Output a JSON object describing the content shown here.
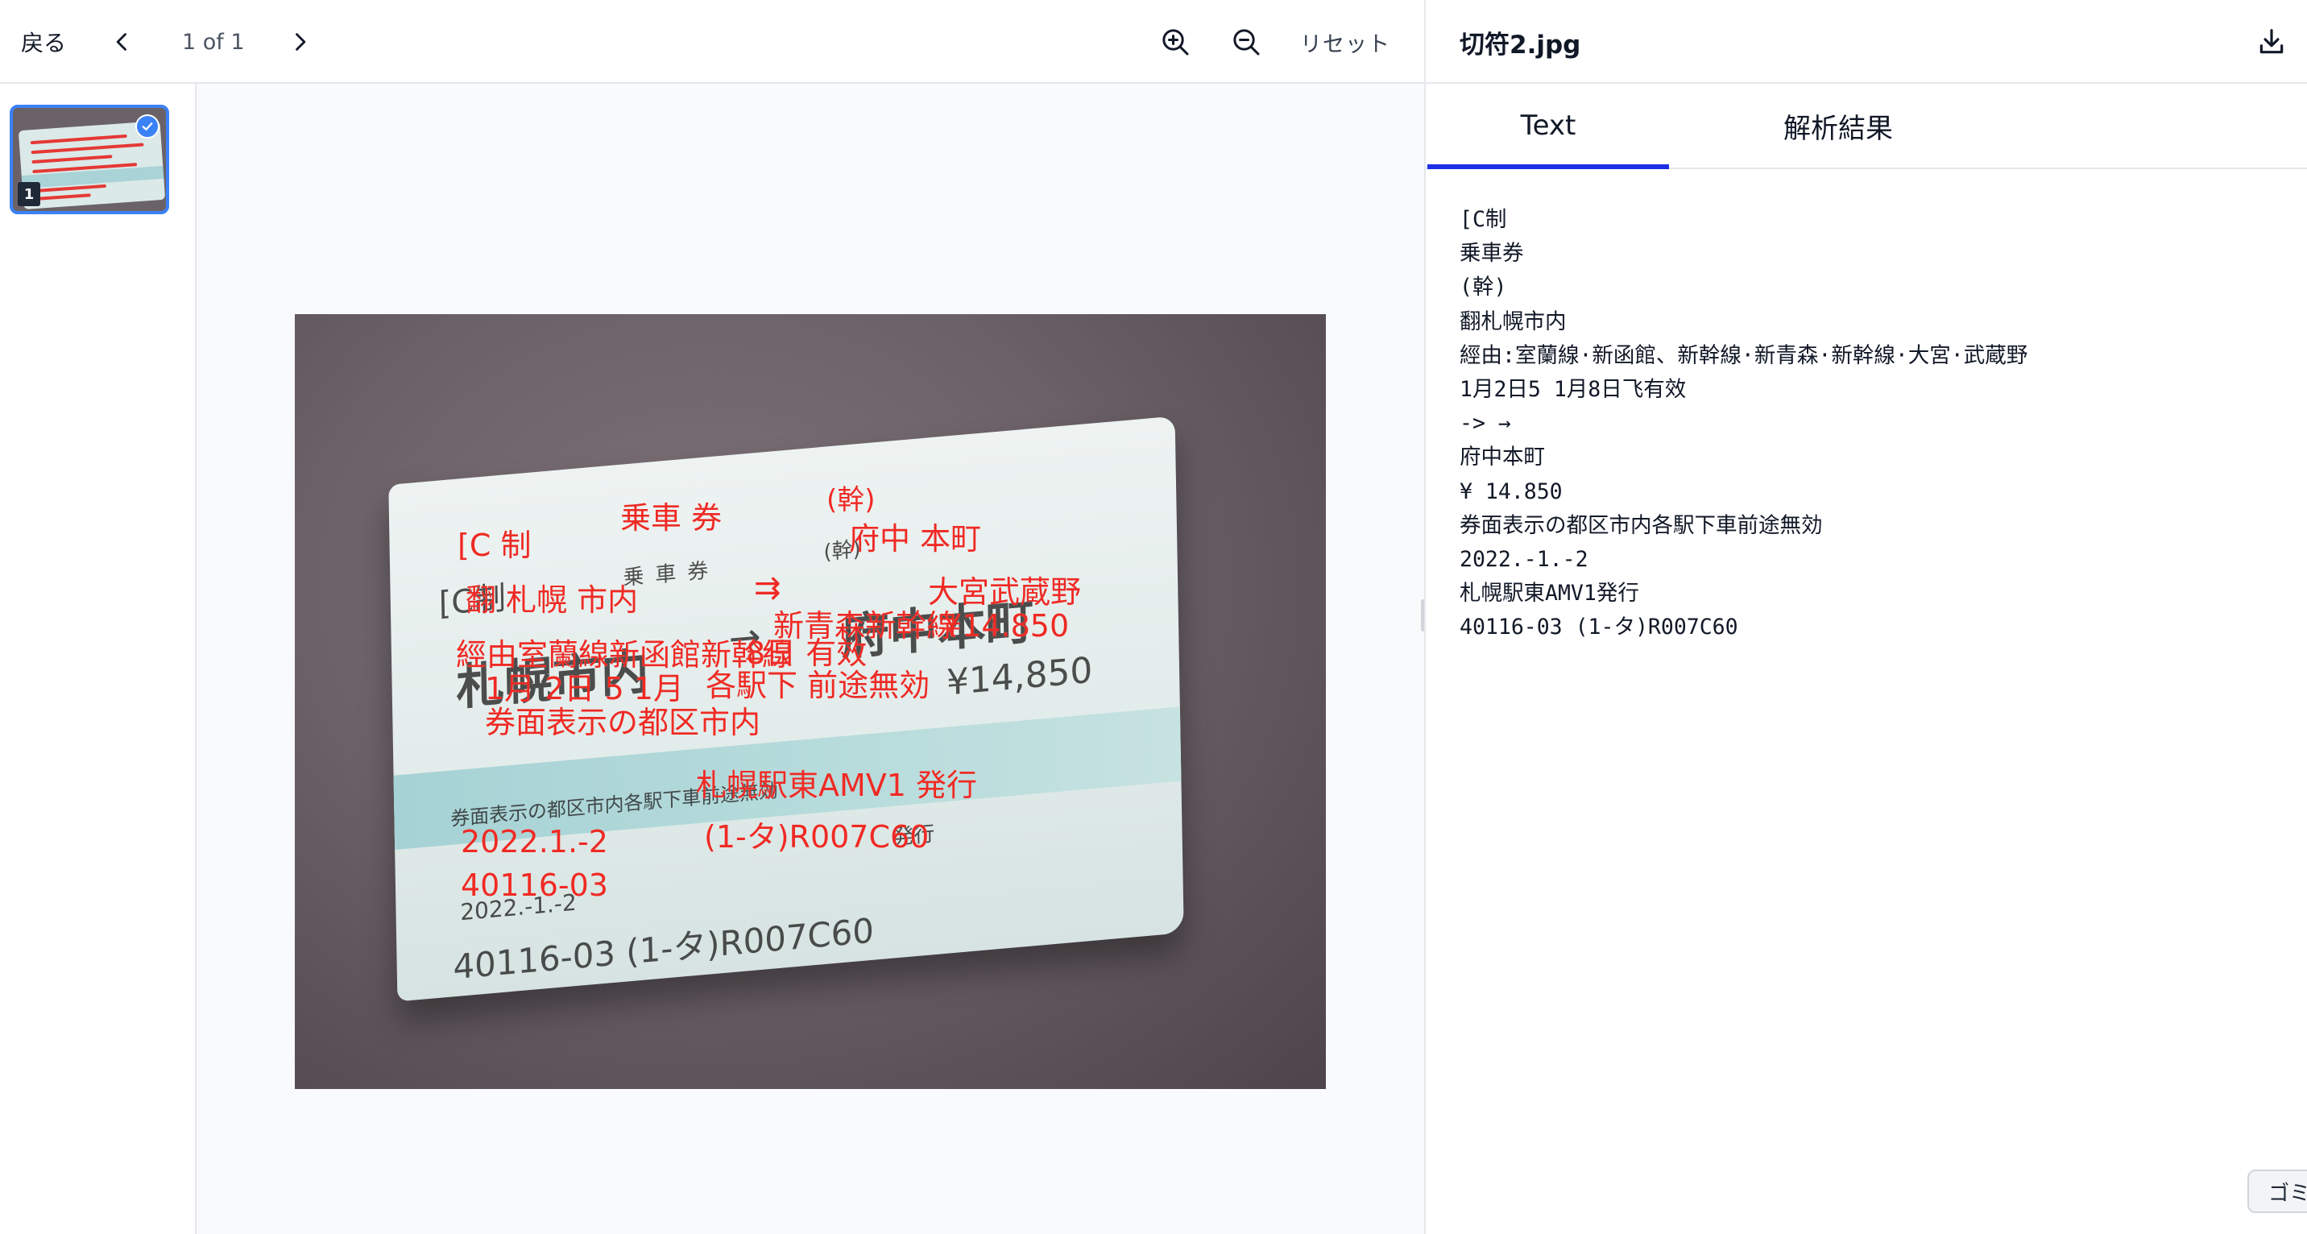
{
  "toolbar": {
    "back_label": "戻る",
    "page_indicator": "1 of 1",
    "reset_label": "リセット"
  },
  "thumbnails": [
    {
      "page_number": "1",
      "selected": true
    }
  ],
  "header": {
    "file_name": "切符2.jpg"
  },
  "tabs": [
    {
      "label": "Text",
      "active": true
    },
    {
      "label": "解析結果",
      "active": false
    }
  ],
  "ocr_text_lines": [
    "[C制",
    "乗車券",
    "(幹)",
    "翻札幌市内",
    "經由:室蘭線·新函館、新幹線·新青森·新幹線·大宮·武蔵野",
    "1月2日5 1月8日飞有效",
    "-> →",
    "府中本町",
    "¥ 14.850",
    "券面表示の都区市内各駅下車前途無効",
    "2022.-1.-2",
    "札幌駅東AMV1発行",
    "40116-03 (1-タ)R007C60"
  ],
  "ticket_print": {
    "c_sei": "[C制",
    "jousha": "乗車券",
    "kan": "(幹)",
    "origin": "札幌市内",
    "dest": "府中本町",
    "arrow": "→",
    "price": "¥14,850",
    "date": "2022.-1.-2",
    "serial": "40116-03 (1-タ)R007C60",
    "notice": "券面表示の都区市内各駅下車前途無効",
    "issued": "発行"
  },
  "overlay_labels": {
    "c_sei": "[C 制",
    "jousha": "乗車 券",
    "kan": "(幹)",
    "fuchu_honmachi": "府中 本町",
    "hon_sapporo": "翻 札幌 市内",
    "arrows": "⇉",
    "omiya_musashino": "大宮武蔵野",
    "shinaomori": "新青森新幹線",
    "price": "¥14.850",
    "via": "經由室蘭線新函館新幹線",
    "valid_day": "8日 有效",
    "jan2": "1月 2日 5 1月",
    "kakueki": "各駅下 前途無効",
    "notice": "券面表示の都区市内",
    "issued": "札幌駅東AMV1 発行",
    "date": "2022.1.-2",
    "code": "(1-タ)R007C60",
    "serial": "40116-03"
  },
  "trash_label": "ゴミ",
  "colors": {
    "accent": "#1d2ee8",
    "thumb_selected": "#3b82f6",
    "overlay_text": "#ef2a24"
  },
  "icons": {
    "prev": "chevron-left-icon",
    "next": "chevron-right-icon",
    "zoom_in": "zoom-in-icon",
    "zoom_out": "zoom-out-icon",
    "download": "download-icon",
    "check": "check-icon"
  }
}
